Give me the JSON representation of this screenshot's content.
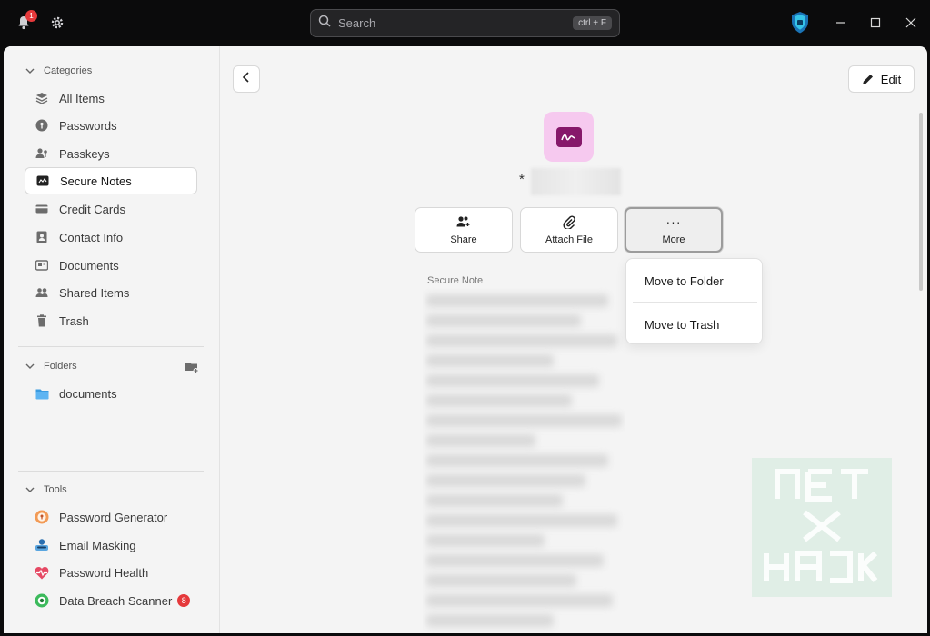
{
  "titlebar": {
    "notification_count": "1",
    "search": {
      "placeholder": "Search",
      "shortcut": "ctrl + F"
    }
  },
  "sidebar": {
    "categories_label": "Categories",
    "categories": [
      {
        "label": "All Items",
        "icon": "layers-icon"
      },
      {
        "label": "Passwords",
        "icon": "key-icon"
      },
      {
        "label": "Passkeys",
        "icon": "passkey-icon"
      },
      {
        "label": "Secure Notes",
        "icon": "note-icon",
        "active": true
      },
      {
        "label": "Credit Cards",
        "icon": "credit-card-icon"
      },
      {
        "label": "Contact Info",
        "icon": "contact-icon"
      },
      {
        "label": "Documents",
        "icon": "document-icon"
      },
      {
        "label": "Shared Items",
        "icon": "people-icon"
      },
      {
        "label": "Trash",
        "icon": "trash-icon"
      }
    ],
    "folders_label": "Folders",
    "folders": [
      {
        "label": "documents",
        "icon": "folder-icon"
      }
    ],
    "tools_label": "Tools",
    "tools": [
      {
        "label": "Password Generator",
        "icon": "generator-icon"
      },
      {
        "label": "Email Masking",
        "icon": "mask-icon"
      },
      {
        "label": "Password Health",
        "icon": "health-icon"
      },
      {
        "label": "Data Breach Scanner",
        "icon": "scanner-icon",
        "badge": "8"
      }
    ]
  },
  "content": {
    "edit_label": "Edit",
    "asterisk": "*",
    "actions": {
      "share": "Share",
      "attach": "Attach File",
      "more": "More",
      "more_glyph": "···"
    },
    "field_label": "Secure Note",
    "menu": {
      "move_folder": "Move to Folder",
      "move_trash": "Move to Trash"
    }
  },
  "colors": {
    "accent_pink": "#f6c9ef",
    "note_purple": "#86186a",
    "badge_red": "#e5393b",
    "titlebar": "#0b0b0c"
  }
}
